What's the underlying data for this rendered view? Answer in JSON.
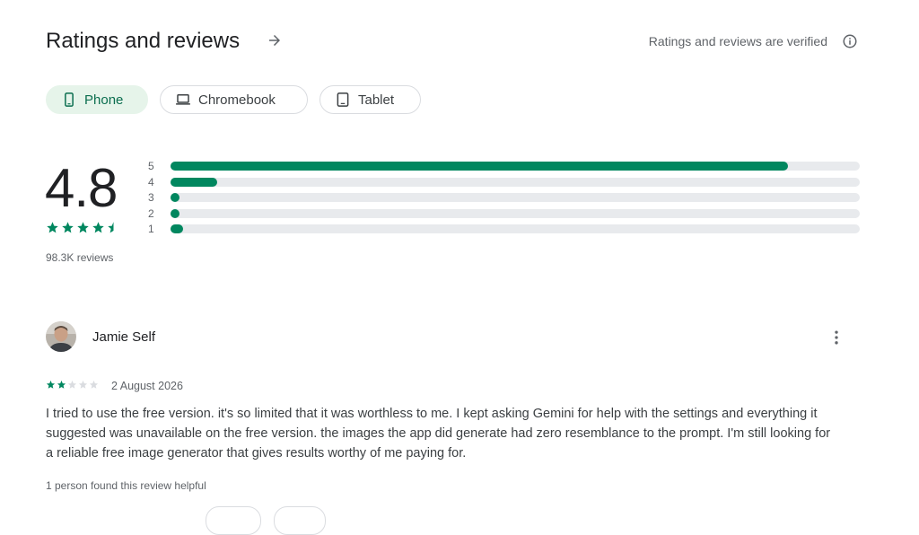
{
  "header": {
    "title": "Ratings and reviews",
    "verified_text": "Ratings and reviews are verified",
    "arrow_icon": "arrow-right-icon",
    "info_icon": "info-icon"
  },
  "device_tabs": [
    {
      "label": "Phone",
      "icon": "phone-icon",
      "selected": true
    },
    {
      "label": "Chromebook",
      "icon": "laptop-icon",
      "selected": false
    },
    {
      "label": "Tablet",
      "icon": "tablet-icon",
      "selected": false
    }
  ],
  "summary": {
    "score": "4.8",
    "stars": 4.5,
    "review_count": "98.3K reviews"
  },
  "distribution": [
    {
      "label": "5",
      "fraction": 0.896
    },
    {
      "label": "4",
      "fraction": 0.068
    },
    {
      "label": "3",
      "fraction": 0.009
    },
    {
      "label": "2",
      "fraction": 0.006
    },
    {
      "label": "1",
      "fraction": 0.018
    }
  ],
  "review": {
    "author": "Jamie Self",
    "rating": 2,
    "max_rating": 5,
    "date": "2 August 2026",
    "body": "I tried to use the free version. it's so limited that it was worthless to me. I kept asking Gemini for help with the settings and everything it suggested was unavailable on the free version. the images the app did generate had zero resemblance to the prompt. I'm still looking for a reliable free image generator that gives results worthy of me paying for.",
    "helpful_text": "1 person found this review helpful",
    "menu_icon": "more-vert-icon"
  },
  "colors": {
    "accent": "#01875f",
    "chip_active_bg": "#e6f4ea",
    "chip_active_text": "#0b6e4f",
    "track": "#e8eaed",
    "empty_star": "#dadce0"
  }
}
